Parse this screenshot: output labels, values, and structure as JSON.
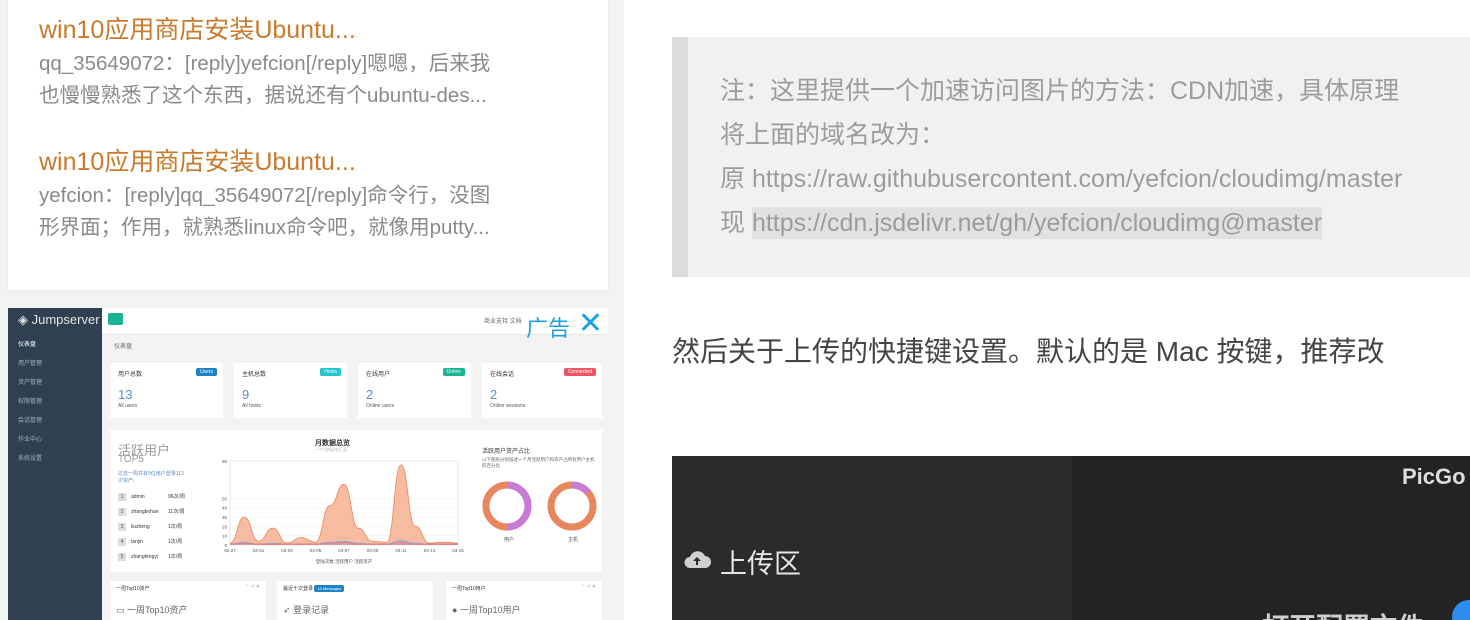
{
  "sidebar": {
    "comments": [
      {
        "title": "win10应用商店安装Ubuntu...",
        "line1": "qq_35649072：[reply]yefcion[/reply]嗯嗯，后来我",
        "line2": "也慢慢熟悉了这个东西，据说还有个ubuntu-des..."
      },
      {
        "title": "win10应用商店安装Ubuntu...",
        "line1": "yefcion：[reply]qq_35649072[/reply]命令行，没图",
        "line2": "形界面；作用，就熟悉linux命令吧，就像用putty..."
      }
    ],
    "ad": {
      "label": "广告",
      "close_icon": "close-icon",
      "brand": "Jumpserver",
      "top_links": "商业支持    文档",
      "crumb": "仪表盘",
      "nav": [
        "仪表盘",
        "用户管理",
        "资产管理",
        "权限管理",
        "会话管理",
        "作业中心",
        "系统设置"
      ],
      "stats": [
        {
          "label": "用户总数",
          "badge": "Users",
          "value": "13",
          "sub": "All users",
          "color": "#1c84c6"
        },
        {
          "label": "主机总数",
          "badge": "Hosts",
          "value": "9",
          "sub": "All hosts",
          "color": "#23c6c8"
        },
        {
          "label": "在线用户",
          "badge": "Online",
          "value": "2",
          "sub": "Online users",
          "color": "#1ab394"
        },
        {
          "label": "在线会话",
          "badge": "Connected",
          "value": "2",
          "sub": "Online sessions",
          "color": "#ed5565"
        }
      ],
      "active": {
        "title": "活跃用户",
        "subtitle": "TOP5",
        "desc": "过去一周共有9位用户登录113次资产。",
        "ranks": [
          {
            "n": "1",
            "name": "admin",
            "val": "96次/周"
          },
          {
            "n": "2",
            "name": "zhangbohan",
            "val": "11次/周"
          },
          {
            "n": "3",
            "name": "liuzheng",
            "val": "1次/周"
          },
          {
            "n": "4",
            "name": "tanjin",
            "val": "1次/周"
          },
          {
            "n": "5",
            "name": "zhangfengyi",
            "val": "1次/周"
          }
        ]
      },
      "monthly": {
        "title": "月数据总览",
        "subtitle": "一个月内历史汇总",
        "legend": "登陆次数  活跃用户  活跃资产"
      },
      "pie": {
        "title": "活跃用户资产占比",
        "desc": "以下图形分别描述一个月活跃用户和资产占所有用户主机的百分比",
        "labels": [
          "用户",
          "主机"
        ]
      },
      "bottom": [
        {
          "head": "一周Top10资产",
          "item": "一周Top10资产",
          "badge": ""
        },
        {
          "head": "最近十次登录",
          "item": "登录记录",
          "badge": "10 Messages"
        },
        {
          "head": "一周Top10用户",
          "item": "一周Top10用户",
          "badge": ""
        }
      ]
    }
  },
  "article": {
    "quote": {
      "line1": "注：这里提供一个加速访问图片的方法：CDN加速，具体原理",
      "line2": "将上面的域名改为：",
      "line3_prefix": "原 ",
      "line3_url": "https://raw.githubusercontent.com/yefcion/cloudimg/master",
      "line4_prefix": "现 ",
      "line4_url": "https://cdn.jsdelivr.net/gh/yefcion/cloudimg@master"
    },
    "paragraph": "然后关于上传的快捷键设置。默认的是 Mac 按键，推荐改",
    "screenshot": {
      "title": "PicGo",
      "upload_label": "上传区",
      "cut_text": "打开配置文件"
    }
  },
  "chart_data": {
    "type": "area",
    "title": "月数据总览",
    "subtitle": "一个月内历史汇总",
    "categories": [
      "02-27",
      "03-01",
      "03-03",
      "03-05",
      "03-07",
      "03-09",
      "03-11",
      "03-13",
      "03-15"
    ],
    "ylim": [
      0,
      90
    ],
    "yticks": [
      0,
      10,
      20,
      30,
      40,
      50,
      90
    ],
    "series": [
      {
        "name": "登陆次数",
        "values": [
          2,
          30,
          4,
          18,
          2,
          8,
          3,
          42,
          65,
          18,
          4,
          3,
          86,
          20,
          2,
          3,
          2
        ],
        "color": "#f4a582"
      },
      {
        "name": "活跃用户",
        "values": [
          1,
          3,
          1,
          2,
          1,
          1,
          1,
          3,
          4,
          2,
          1,
          1,
          5,
          2,
          1,
          1,
          1
        ],
        "color": "#7eb3e8"
      },
      {
        "name": "活跃资产",
        "values": [
          1,
          2,
          1,
          1,
          1,
          1,
          1,
          2,
          3,
          1,
          1,
          1,
          3,
          1,
          1,
          1,
          1
        ],
        "color": "#e57373"
      }
    ]
  }
}
